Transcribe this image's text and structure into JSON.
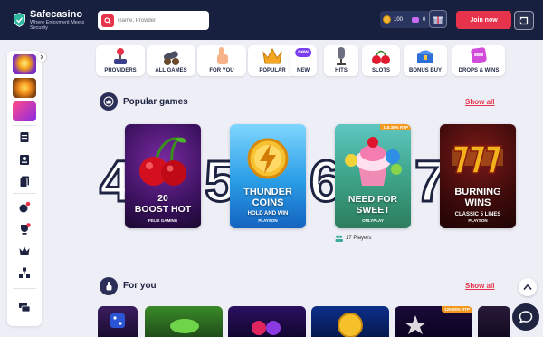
{
  "header": {
    "brand_title": "Safecasino",
    "brand_tagline": "Where Enjoyment Meets Security",
    "search_placeholder": "Game, Provider",
    "wallet_coins": "100",
    "wallet_gems": "0",
    "join_label": "Join now"
  },
  "categories": [
    {
      "label": "PROVIDERS",
      "icon": "joystick-icon"
    },
    {
      "label": "ALL GAMES",
      "icon": "cannon-icon"
    },
    {
      "label": "FOR YOU",
      "icon": "pointing-hand-icon"
    },
    {
      "label": "POPULAR",
      "icon": "crown-icon"
    },
    {
      "label": "NEW",
      "badge": "new",
      "icon": "new-badge-icon"
    },
    {
      "label": "HITS",
      "icon": "microphone-icon"
    },
    {
      "label": "SLOTS",
      "icon": "cherries-icon"
    },
    {
      "label": "BONUS BUY",
      "icon": "treasure-chest-icon"
    },
    {
      "label": "DROPS & WINS",
      "icon": "drops-wins-icon"
    }
  ],
  "popular": {
    "title": "Popular games",
    "show_all": "Show all",
    "games": [
      {
        "rank": "4",
        "title_line1": "20",
        "title_line2": "BOOST HOT",
        "provider": "FELIX GAMING"
      },
      {
        "rank": "5",
        "title_line1": "THUNDER",
        "title_line2": "COINS",
        "subtitle": "HOLD AND WIN",
        "provider": "PLAYSON"
      },
      {
        "rank": "6",
        "title_line1": "NEED FOR",
        "title_line2": "SWEET",
        "provider": "ONLYPLAY",
        "rtp": "118.38% RTP",
        "players": "17 Players"
      },
      {
        "rank": "7",
        "title_line1": "BURNING",
        "title_line2": "WINS",
        "subtitle": "CLASSIC 5 LINES",
        "provider": "PLAYSON"
      }
    ]
  },
  "for_you": {
    "title": "For you",
    "show_all": "Show all",
    "rtp_badge": "120.05% RTP"
  },
  "colors": {
    "header_bg": "#17203f",
    "accent_red": "#e6324b",
    "rtp_orange": "#f39a1e",
    "page_bg": "#eeeef6"
  }
}
